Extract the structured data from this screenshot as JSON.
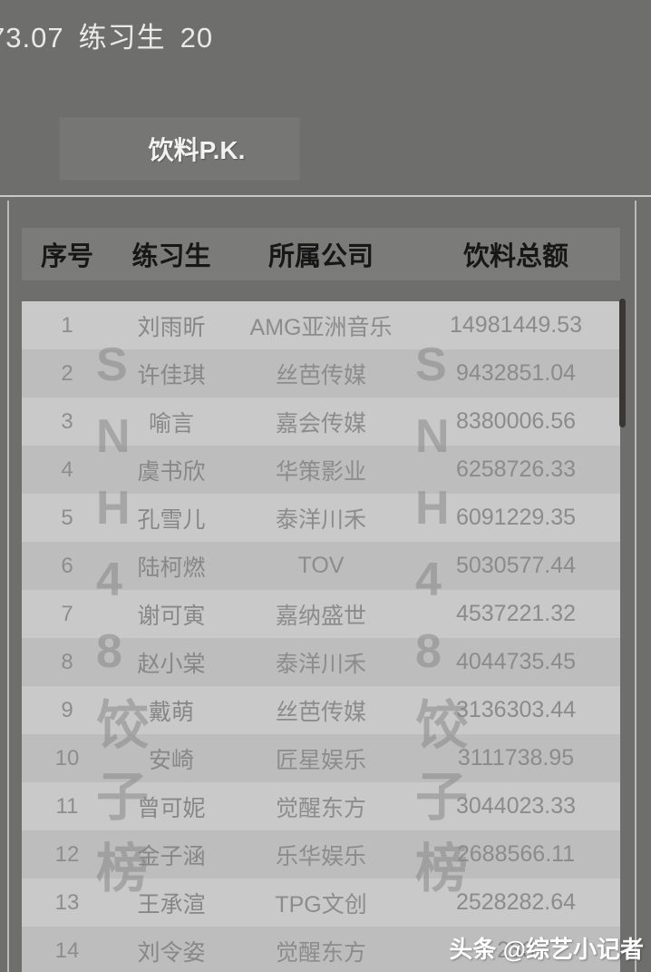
{
  "top": {
    "status_fragment": "73.07",
    "status_label": "练习生",
    "status_count": "20",
    "pk_button_label": "饮料P.K."
  },
  "table": {
    "headers": {
      "rank": "序号",
      "name": "练习生",
      "company": "所属公司",
      "amount": "饮料总额"
    },
    "rows": [
      {
        "rank": "1",
        "name": "刘雨昕",
        "company": "AMG亚洲音乐",
        "amount": "14981449.53"
      },
      {
        "rank": "2",
        "name": "许佳琪",
        "company": "丝芭传媒",
        "amount": "9432851.04"
      },
      {
        "rank": "3",
        "name": "喻言",
        "company": "嘉会传媒",
        "amount": "8380006.56"
      },
      {
        "rank": "4",
        "name": "虞书欣",
        "company": "华策影业",
        "amount": "6258726.33"
      },
      {
        "rank": "5",
        "name": "孔雪儿",
        "company": "泰洋川禾",
        "amount": "6091229.35"
      },
      {
        "rank": "6",
        "name": "陆柯燃",
        "company": "TOV",
        "amount": "5030577.44"
      },
      {
        "rank": "7",
        "name": "谢可寅",
        "company": "嘉纳盛世",
        "amount": "4537221.32"
      },
      {
        "rank": "8",
        "name": "赵小棠",
        "company": "泰洋川禾",
        "amount": "4044735.45"
      },
      {
        "rank": "9",
        "name": "戴萌",
        "company": "丝芭传媒",
        "amount": "3136303.44"
      },
      {
        "rank": "10",
        "name": "安崎",
        "company": "匠星娱乐",
        "amount": "3111738.95"
      },
      {
        "rank": "11",
        "name": "曾可妮",
        "company": "觉醒东方",
        "amount": "3044023.33"
      },
      {
        "rank": "12",
        "name": "金子涵",
        "company": "乐华娱乐",
        "amount": "2688566.11"
      },
      {
        "rank": "13",
        "name": "王承渲",
        "company": "TPG文创",
        "amount": "2528282.64"
      },
      {
        "rank": "14",
        "name": "刘令姿",
        "company": "觉醒东方",
        "amount": "233"
      }
    ]
  },
  "watermarks": {
    "overlay_chars": [
      "S",
      "N",
      "H",
      "4",
      "8",
      "饺",
      "子",
      "榜"
    ],
    "brand": "头条 @综艺小记者"
  },
  "colors": {
    "page_background": "#6e6e6d",
    "header_row": "#7b7b7a",
    "row_odd": "#c9c9c9",
    "row_even": "#bdbdbd",
    "scrollbar_thumb": "#3b3634",
    "top_text": "#e9e9e9"
  }
}
